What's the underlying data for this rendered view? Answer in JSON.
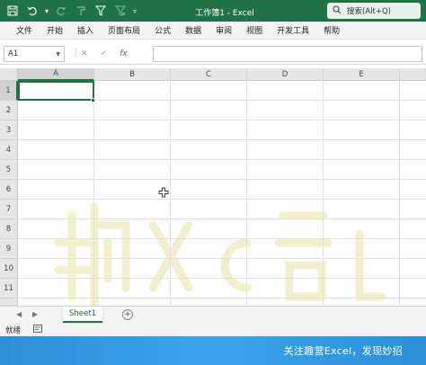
{
  "window": {
    "title": "工作簿1  -  Excel"
  },
  "search": {
    "label": "搜索(Alt+Q)"
  },
  "quick_access": {
    "icons": [
      "save-icon",
      "undo-icon",
      "redo-icon",
      "format-painter-icon",
      "filter-icon",
      "clear-filter-icon",
      "customize-icon"
    ]
  },
  "menu": {
    "items": [
      "文件",
      "开始",
      "插入",
      "页面布局",
      "公式",
      "数据",
      "审阅",
      "视图",
      "开发工具",
      "帮助"
    ]
  },
  "formula_bar": {
    "name_box": "A1",
    "formula": ""
  },
  "sheet": {
    "columns": [
      "A",
      "B",
      "C",
      "D",
      "E"
    ],
    "rows": [
      "1",
      "2",
      "3",
      "4",
      "5",
      "6",
      "7",
      "8",
      "9",
      "10",
      "11"
    ],
    "active_cell": "A1"
  },
  "sheet_tabs": {
    "tabs": [
      "Sheet1"
    ],
    "active": "Sheet1"
  },
  "status": {
    "text": "就绪"
  },
  "watermark": {
    "text": "趣Excel"
  },
  "banner": {
    "text": "关注趣营Excel，发现妙招"
  },
  "colors": {
    "accent": "#217346",
    "banner": "#3aa4ec"
  }
}
